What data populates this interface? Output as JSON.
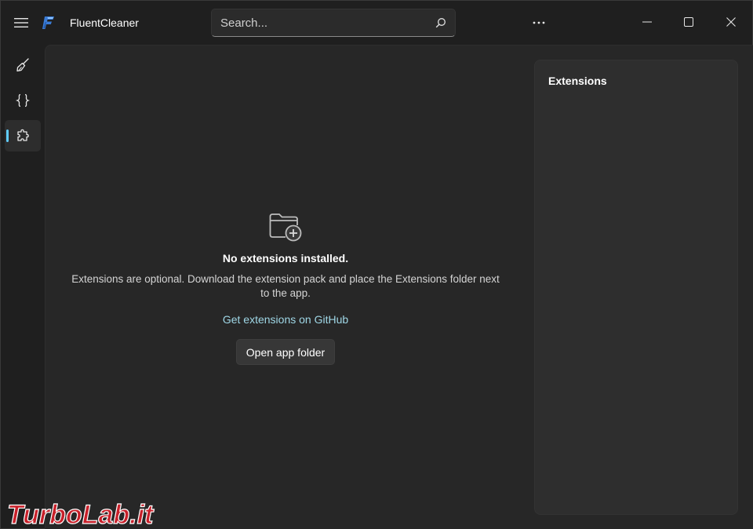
{
  "app": {
    "title": "FluentCleaner"
  },
  "search": {
    "placeholder": "Search..."
  },
  "nav": {
    "items": [
      {
        "name": "cleaner",
        "icon": "broom-icon"
      },
      {
        "name": "developer",
        "icon": "braces-icon"
      },
      {
        "name": "extensions",
        "icon": "puzzle-icon",
        "selected": true
      }
    ]
  },
  "empty_state": {
    "title": "No extensions installed.",
    "description": "Extensions are optional. Download the extension pack and place the Extensions folder next to the app.",
    "link_label": "Get extensions on GitHub",
    "button_label": "Open app folder"
  },
  "side_panel": {
    "title": "Extensions"
  },
  "watermark": {
    "text": "TurboLab.it"
  },
  "colors": {
    "background": "#1f1f1f",
    "content": "#272727",
    "panel": "#2e2e2e",
    "accent": "#60cdff",
    "link": "#9fd7e6"
  }
}
